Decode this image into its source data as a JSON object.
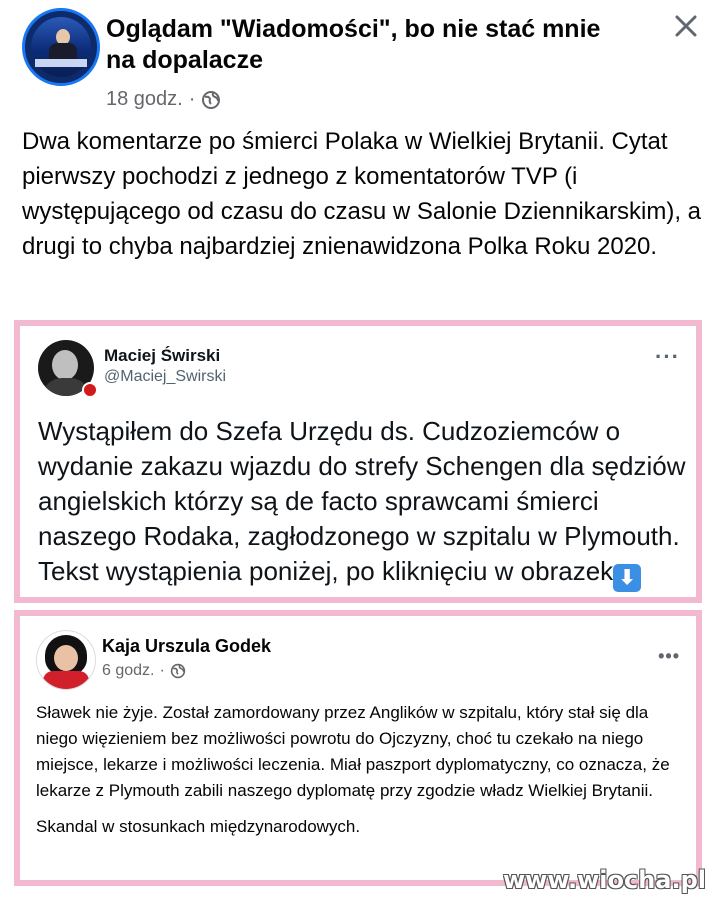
{
  "post": {
    "page_name": "Oglądam \"Wiadomości\", bo nie stać mnie na dopalacze",
    "time": "18 godz.",
    "separator": "·",
    "privacy_icon": "globe-icon",
    "text": "Dwa komentarze po śmierci Polaka w Wielkiej Brytanii. Cytat pierwszy pochodzi z jednego z komentatorów TVP (i występującego od czasu do czasu w Salonie Dziennikarskim), a drugi to chyba najbardziej znienawidzona Polka Roku 2020."
  },
  "tweet": {
    "name": "Maciej Świrski",
    "handle": "@Maciej_Swirski",
    "more": "···",
    "text": "Wystąpiłem do Szefa Urzędu ds. Cudzoziemców o wydanie zakazu wjazdu do strefy Schengen dla sędziów angielskich którzy są de facto sprawcami śmierci naszego Rodaka, zagłodzonego w szpitalu w Plymouth. Tekst wystąpienia poniżej, po kliknięciu w obrazek",
    "emoji": "⬇"
  },
  "fb_quote": {
    "name": "Kaja Urszula Godek",
    "time": "6 godz.",
    "separator": "·",
    "more": "•••",
    "paragraph1": "Sławek nie żyje. Został zamordowany przez Anglików w szpitalu, który stał się dla niego więzieniem bez możliwości powrotu do Ojczyzny, choć tu czekało na niego miejsce, lekarze i możliwości leczenia. Miał paszport dyplomatyczny, co oznacza, że lekarze z Plymouth zabili naszego dyplomatę przy zgodzie władz Wielkiej Brytanii.",
    "paragraph2": "Skandal w stosunkach międzynarodowych."
  },
  "watermark": "www.wiocha.pl",
  "colors": {
    "frame": "#f2b9d0",
    "facebook_blue": "#1877f2",
    "meta_gray": "#65676b"
  }
}
